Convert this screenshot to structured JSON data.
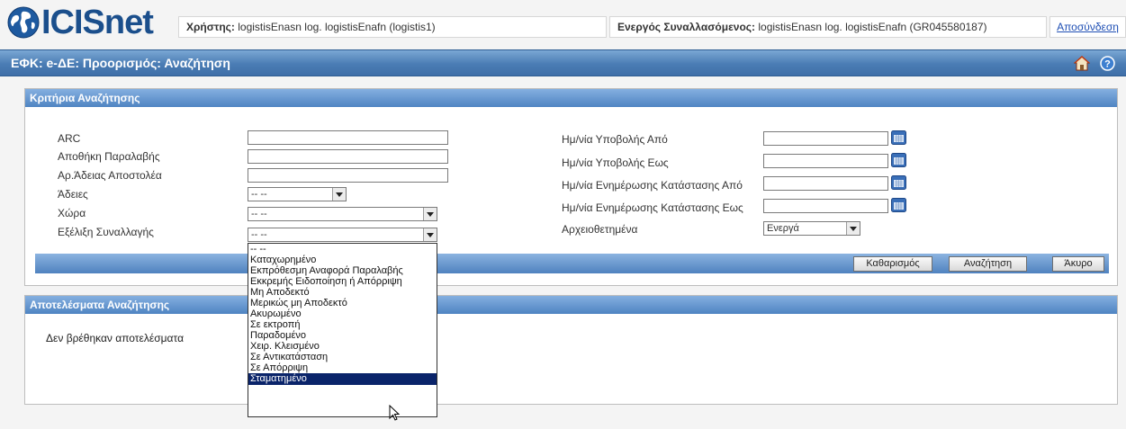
{
  "app": {
    "logo_text": "ICISnet",
    "user_label": "Χρήστης:",
    "user_value": "logistisEnasn log. logistisEnafn (logistis1)",
    "trader_label": "Ενεργός Συναλλασόμενος:",
    "trader_value": "logistisEnasn log. logistisEnafn (GR045580187)",
    "logout": "Αποσύνδεση"
  },
  "page": {
    "title": "ΕΦΚ: e-ΔΕ: Προορισμός: Αναζήτηση",
    "icons": [
      "home-icon",
      "help-icon"
    ]
  },
  "criteria": {
    "header": "Κριτήρια Αναζήτησης",
    "left_fields": [
      {
        "label": "ARC",
        "type": "text",
        "value": ""
      },
      {
        "label": "Αποθήκη Παραλαβής",
        "type": "text",
        "value": ""
      },
      {
        "label": "Αρ.Άδειας Αποστολέα",
        "type": "text",
        "value": ""
      },
      {
        "label": "Άδειες",
        "type": "select",
        "value": "-- --"
      },
      {
        "label": "Χώρα",
        "type": "select",
        "value": "-- --"
      },
      {
        "label": "Εξέλιξη Συναλλαγής",
        "type": "select",
        "value": "-- --"
      }
    ],
    "right_fields": [
      {
        "label": "Ημ/νία Υποβολής Από",
        "type": "date",
        "value": ""
      },
      {
        "label": "Ημ/νία Υποβολής Εως",
        "type": "date",
        "value": ""
      },
      {
        "label": "Ημ/νία Ενημέρωσης Κατάστασης Από",
        "type": "date",
        "value": ""
      },
      {
        "label": "Ημ/νία Ενημέρωσης Κατάστασης Εως",
        "type": "date",
        "value": ""
      },
      {
        "label": "Αρχειοθετημένα",
        "type": "select",
        "value": "Ενεργά"
      }
    ],
    "buttons": {
      "clear": "Καθαρισμός",
      "search": "Αναζήτηση",
      "cancel": "Άκυρο"
    }
  },
  "results": {
    "header": "Αποτελέσματα Αναζήτησης",
    "empty_message": "Δεν βρέθηκαν αποτελέσματα"
  },
  "status_dropdown": {
    "options": [
      "-- --",
      "Καταχωρημένο",
      "Εκπρόθεσμη Αναφορά Παραλαβής",
      "Εκκρεμής Ειδοποίηση ή Απόρριψη",
      "Μη Αποδεκτό",
      "Μερικώς μη Αποδεκτό",
      "Ακυρωμένο",
      "Σε εκτροπή",
      "Παραδομένο",
      "Χειρ. Κλεισμένο",
      "Σε Αντικατάσταση",
      "Σε Απόρριψη",
      "Σταματημένο"
    ],
    "highlighted": "Σταματημένο"
  },
  "colors": {
    "title_bar": "#4a7cb4",
    "panel_header": "#5a8dcb",
    "logo": "#1b4f8c",
    "link": "#1f4fb4",
    "highlight": "#0a246a"
  }
}
